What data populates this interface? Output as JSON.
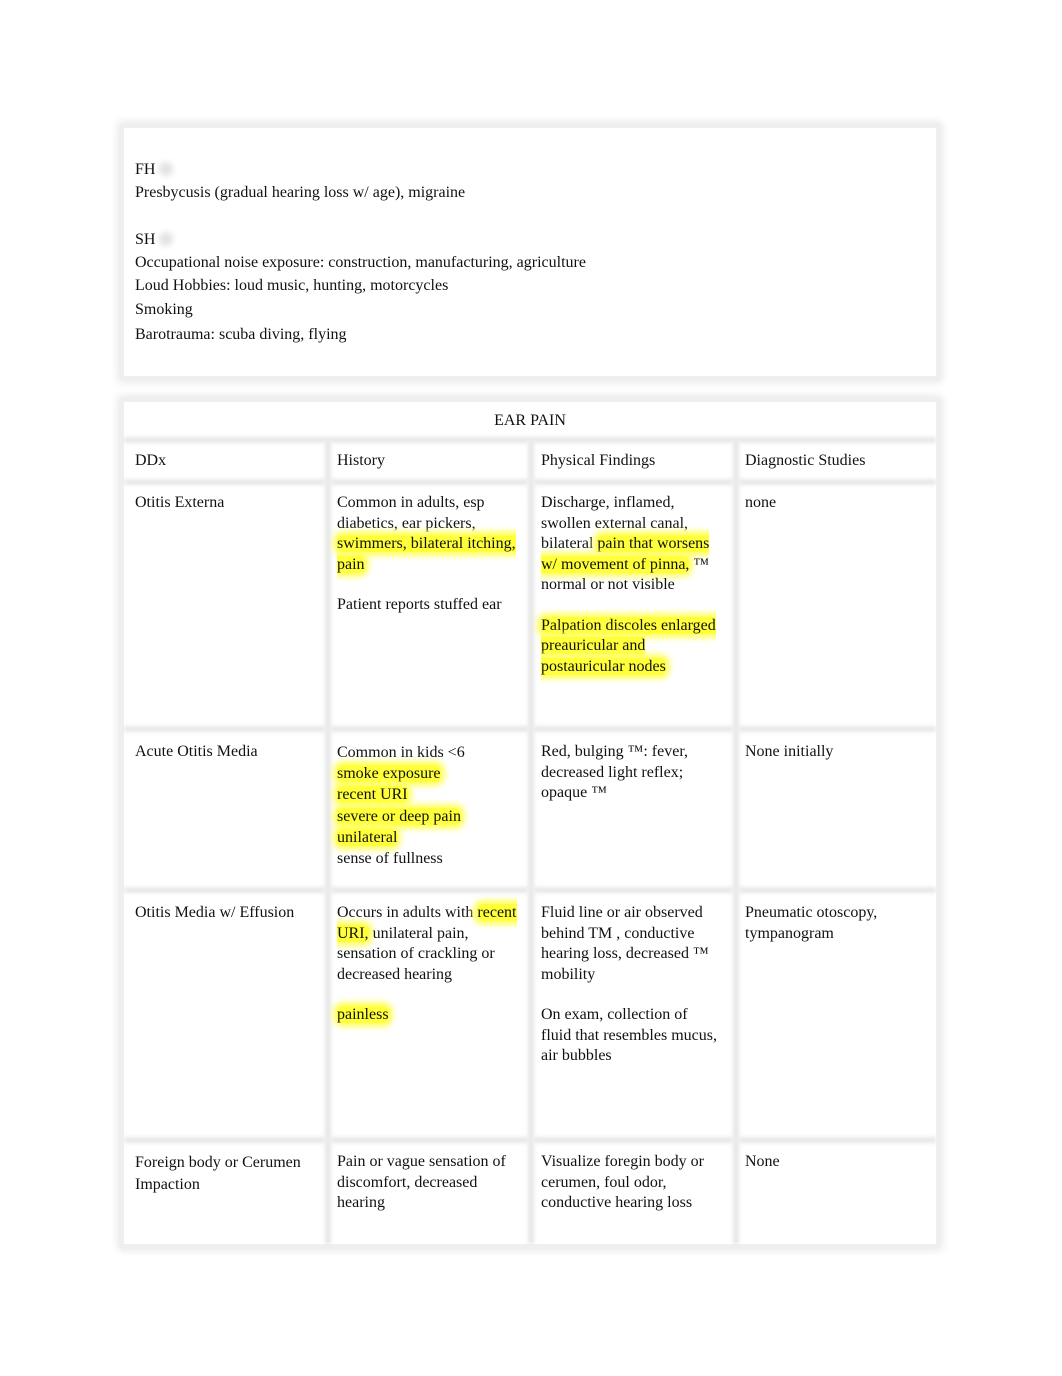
{
  "history_box": {
    "fh_label": "FH",
    "fh_text": "Presbycusis (gradual hearing loss w/ age), migraine",
    "sh_label": "SH",
    "sh_items": [
      "Occupational noise exposure: construction, manufacturing, agriculture",
      "Loud Hobbies: loud music, hunting, motorcycles",
      "Smoking",
      "Barotrauma: scuba diving, flying"
    ]
  },
  "table": {
    "title": "EAR PAIN",
    "headers": [
      "DDx",
      "History",
      "Physical Findings",
      "Diagnostic Studies"
    ],
    "highlight_color": "#ffff3a",
    "rows": [
      {
        "ddx": "Otitis Externa",
        "history": {
          "p1": {
            "plain": "Common in adults, esp diabetics, ear pickers, ",
            "highlight": "swimmers, bilateral itching, pain"
          },
          "p2": "Patient reports stuffed ear"
        },
        "physical": {
          "p1": {
            "plain": "Discharge, inflamed, swollen external canal, bilateral ",
            "highlight": "pain that worsens w/ movement of pinna,",
            "rest": " ™ normal or not visible"
          },
          "p2": "Palpation discoles enlarged preauricular and postauricular nodes"
        },
        "diagnostic": "none"
      },
      {
        "ddx": "Acute Otitis Media",
        "history": {
          "line1": "Common in kids <6",
          "highlighted_lines": [
            "smoke exposure",
            "recent URI",
            "severe or deep pain",
            "unilateral"
          ],
          "line_last": "sense of fullness"
        },
        "physical": "Red, bulging ™: fever, decreased light reflex; opaque ™",
        "diagnostic": "None initially"
      },
      {
        "ddx": "Otitis Media w/ Effusion",
        "history": {
          "p1_start": "Occurs in adults with ",
          "p1_highlight": "recent URI,",
          "p1_rest": " unilateral pain, sensation of crackling or decreased hearing",
          "p2": "painless"
        },
        "physical": {
          "p1": "Fluid line or air observed behind TM , conductive hearing loss, decreased ™ mobility",
          "p2": "On exam, collection of fluid that resembles mucus, air bubbles"
        },
        "diagnostic": "Pneumatic otoscopy, tympanogram"
      },
      {
        "ddx": "Foreign body or Cerumen Impaction",
        "history": "Pain or vague sensation of discomfort, decreased hearing",
        "physical": "Visualize foregin body or cerumen, foul odor, conductive hearing loss",
        "diagnostic": "None"
      }
    ]
  }
}
